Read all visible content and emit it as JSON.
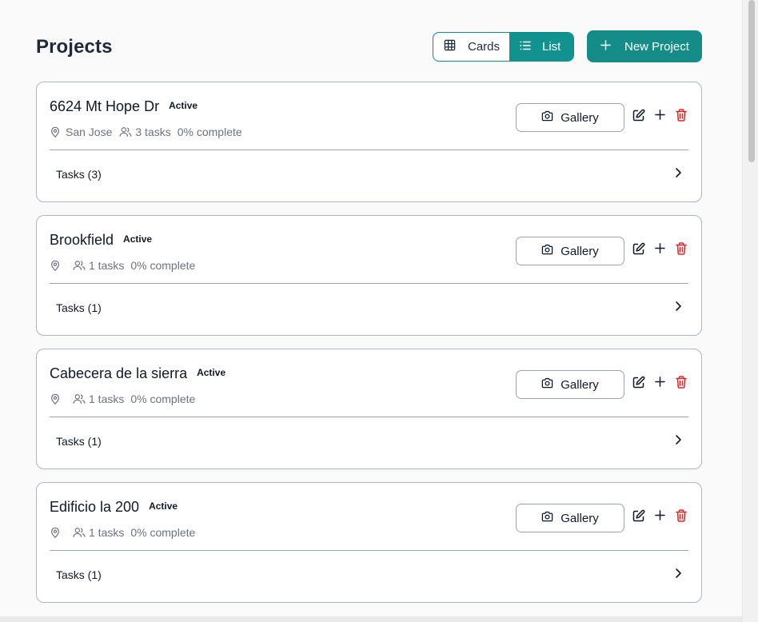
{
  "header": {
    "title": "Projects",
    "view_toggle": {
      "cards_label": "Cards",
      "list_label": "List",
      "selected": "List"
    },
    "new_project_label": "New Project"
  },
  "colors": {
    "accent": "#158c87",
    "delete": "#dc2626",
    "card_border": "#a9b7d0"
  },
  "projects": [
    {
      "name": "6624 Mt Hope Dr",
      "status": "Active",
      "location": "San Jose",
      "tasks_count": "3 tasks",
      "progress": "0% complete",
      "gallery_label": "Gallery",
      "tasks_label": "Tasks (3)"
    },
    {
      "name": "Brookfield",
      "status": "Active",
      "location": "",
      "tasks_count": "1 tasks",
      "progress": "0% complete",
      "gallery_label": "Gallery",
      "tasks_label": "Tasks (1)"
    },
    {
      "name": "Cabecera de la sierra",
      "status": "Active",
      "location": "",
      "tasks_count": "1 tasks",
      "progress": "0% complete",
      "gallery_label": "Gallery",
      "tasks_label": "Tasks (1)"
    },
    {
      "name": "Edificio la 200",
      "status": "Active",
      "location": "",
      "tasks_count": "1 tasks",
      "progress": "0% complete",
      "gallery_label": "Gallery",
      "tasks_label": "Tasks (1)"
    }
  ],
  "icons": {
    "location": "map-pin-icon",
    "users": "users-icon",
    "gallery": "camera-icon",
    "edit": "edit-icon",
    "add": "plus-icon",
    "delete": "trash-icon",
    "expand": "chevron-right-icon",
    "cards_view": "grid-icon",
    "list_view": "list-icon",
    "new": "plus-icon"
  }
}
